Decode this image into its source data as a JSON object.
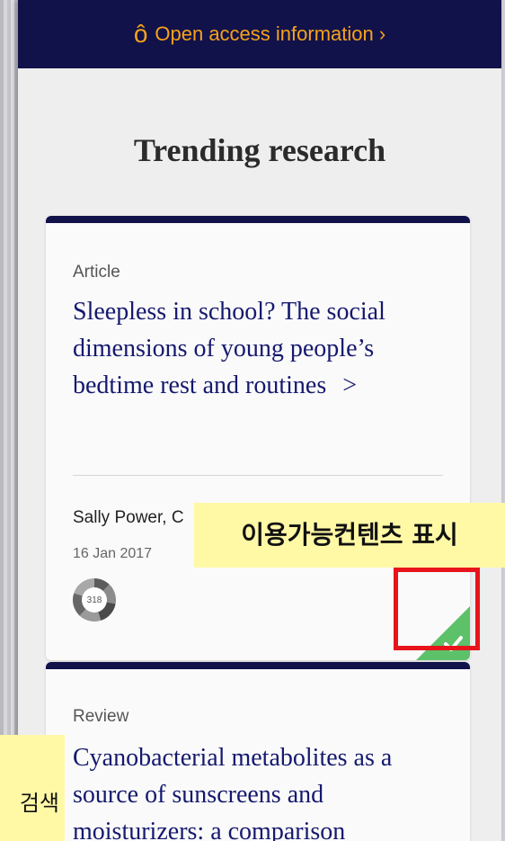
{
  "banner": {
    "text": "Open access information ›",
    "icon": "open-access-icon"
  },
  "section": {
    "title": "Trending research"
  },
  "cards": [
    {
      "type": "Article",
      "title": "Sleepless in school? The social dimensions of young people’s bedtime rest and routines",
      "chevron": ">",
      "authors": "Sally Power, C",
      "date": "16 Jan 2017",
      "altmetric_score": "318",
      "access_badge": "check-icon"
    },
    {
      "type": "Review",
      "title": "Cyanobacterial metabolites as a source of sunscreens and moisturizers: a comparison"
    }
  ],
  "annotations": {
    "main_label": "이용가능컨텐츠 표시",
    "left_label": "검색"
  },
  "colors": {
    "navy": "#11124a",
    "orange": "#f7a21a",
    "title_blue": "#15196e",
    "highlight_red": "#e8141b",
    "callout_yellow": "#fff9a6",
    "badge_green": "#5dc16a"
  }
}
